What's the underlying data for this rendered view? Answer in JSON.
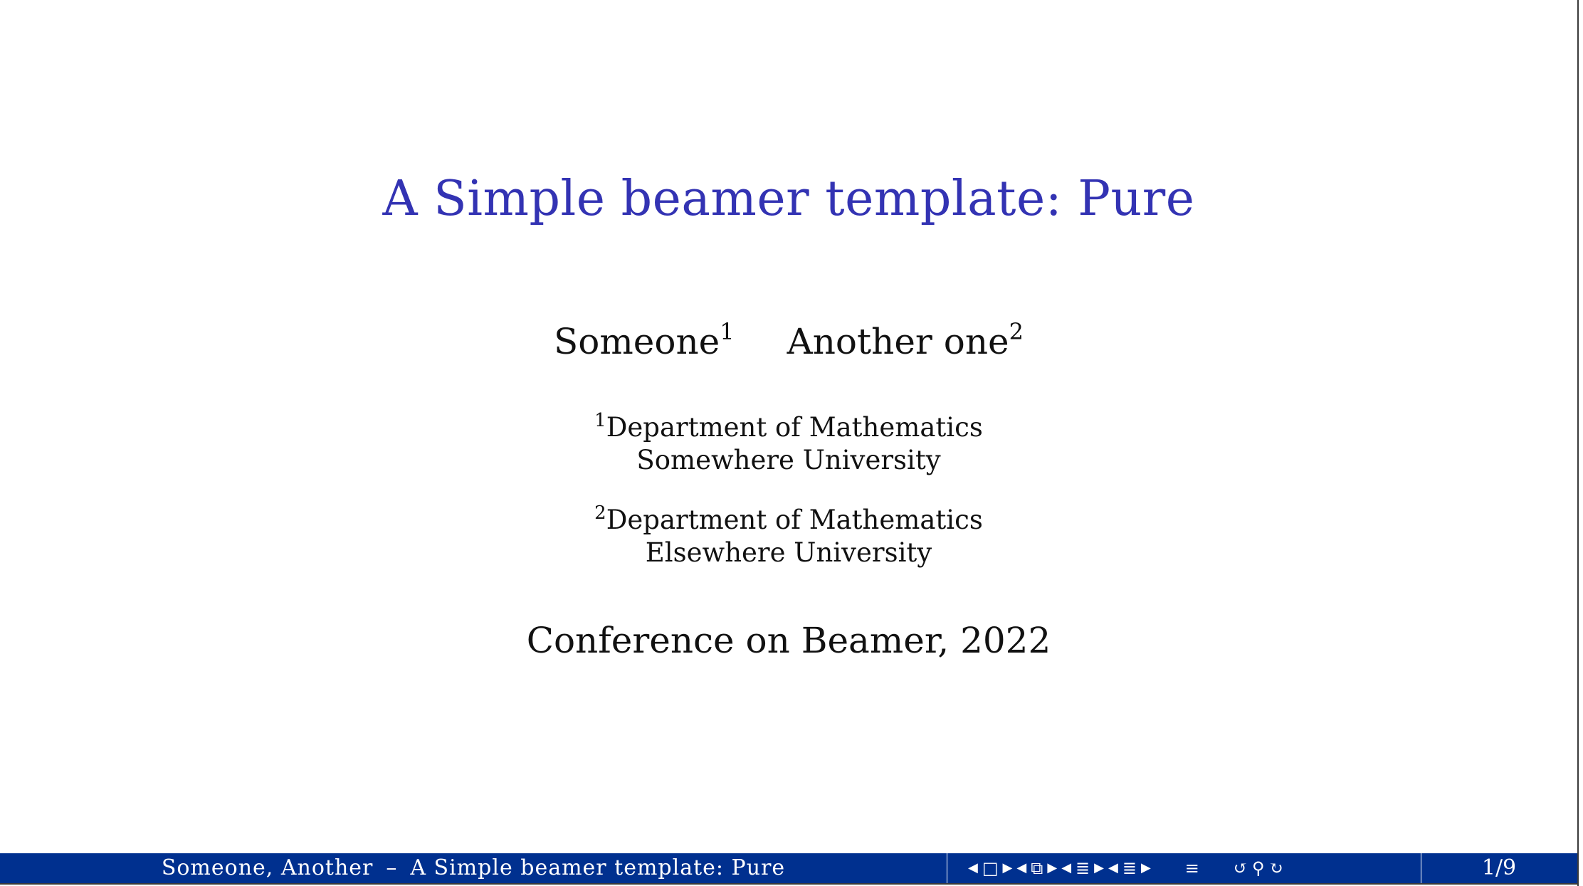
{
  "slide": {
    "title": "A Simple beamer template: Pure",
    "authors": [
      {
        "name": "Someone",
        "mark": "1"
      },
      {
        "name": "Another one",
        "mark": "2"
      }
    ],
    "institutes": [
      {
        "mark": "1",
        "line1": "Department of Mathematics",
        "line2": "Somewhere University"
      },
      {
        "mark": "2",
        "line1": "Department of Mathematics",
        "line2": "Elsewhere University"
      }
    ],
    "date": "Conference on Beamer, 2022"
  },
  "footer": {
    "short_authors": "Someone, Another",
    "separator": "–",
    "short_title": "A Simple beamer template: Pure",
    "page": "1/9"
  },
  "colors": {
    "title": "#3333b3",
    "footer_background": "#00308f",
    "footer_text": "#ffffff"
  },
  "nav_icons": [
    "frame-back-icon",
    "frame-icon",
    "frame-forward-icon",
    "subsection-back-icon",
    "subsection-icon",
    "subsection-forward-icon",
    "section-back-icon",
    "section-icon",
    "section-forward-icon",
    "slide-back-icon",
    "slide-icon",
    "slide-forward-icon",
    "document-icon",
    "undo-icon",
    "search-icon",
    "redo-icon"
  ]
}
